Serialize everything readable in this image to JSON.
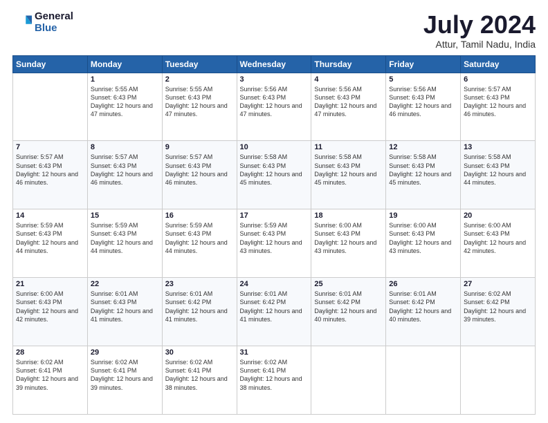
{
  "logo": {
    "general": "General",
    "blue": "Blue"
  },
  "title": "July 2024",
  "subtitle": "Attur, Tamil Nadu, India",
  "headers": [
    "Sunday",
    "Monday",
    "Tuesday",
    "Wednesday",
    "Thursday",
    "Friday",
    "Saturday"
  ],
  "weeks": [
    [
      {
        "day": "",
        "sunrise": "",
        "sunset": "",
        "daylight": ""
      },
      {
        "day": "1",
        "sunrise": "Sunrise: 5:55 AM",
        "sunset": "Sunset: 6:43 PM",
        "daylight": "Daylight: 12 hours and 47 minutes."
      },
      {
        "day": "2",
        "sunrise": "Sunrise: 5:55 AM",
        "sunset": "Sunset: 6:43 PM",
        "daylight": "Daylight: 12 hours and 47 minutes."
      },
      {
        "day": "3",
        "sunrise": "Sunrise: 5:56 AM",
        "sunset": "Sunset: 6:43 PM",
        "daylight": "Daylight: 12 hours and 47 minutes."
      },
      {
        "day": "4",
        "sunrise": "Sunrise: 5:56 AM",
        "sunset": "Sunset: 6:43 PM",
        "daylight": "Daylight: 12 hours and 47 minutes."
      },
      {
        "day": "5",
        "sunrise": "Sunrise: 5:56 AM",
        "sunset": "Sunset: 6:43 PM",
        "daylight": "Daylight: 12 hours and 46 minutes."
      },
      {
        "day": "6",
        "sunrise": "Sunrise: 5:57 AM",
        "sunset": "Sunset: 6:43 PM",
        "daylight": "Daylight: 12 hours and 46 minutes."
      }
    ],
    [
      {
        "day": "7",
        "sunrise": "Sunrise: 5:57 AM",
        "sunset": "Sunset: 6:43 PM",
        "daylight": "Daylight: 12 hours and 46 minutes."
      },
      {
        "day": "8",
        "sunrise": "Sunrise: 5:57 AM",
        "sunset": "Sunset: 6:43 PM",
        "daylight": "Daylight: 12 hours and 46 minutes."
      },
      {
        "day": "9",
        "sunrise": "Sunrise: 5:57 AM",
        "sunset": "Sunset: 6:43 PM",
        "daylight": "Daylight: 12 hours and 46 minutes."
      },
      {
        "day": "10",
        "sunrise": "Sunrise: 5:58 AM",
        "sunset": "Sunset: 6:43 PM",
        "daylight": "Daylight: 12 hours and 45 minutes."
      },
      {
        "day": "11",
        "sunrise": "Sunrise: 5:58 AM",
        "sunset": "Sunset: 6:43 PM",
        "daylight": "Daylight: 12 hours and 45 minutes."
      },
      {
        "day": "12",
        "sunrise": "Sunrise: 5:58 AM",
        "sunset": "Sunset: 6:43 PM",
        "daylight": "Daylight: 12 hours and 45 minutes."
      },
      {
        "day": "13",
        "sunrise": "Sunrise: 5:58 AM",
        "sunset": "Sunset: 6:43 PM",
        "daylight": "Daylight: 12 hours and 44 minutes."
      }
    ],
    [
      {
        "day": "14",
        "sunrise": "Sunrise: 5:59 AM",
        "sunset": "Sunset: 6:43 PM",
        "daylight": "Daylight: 12 hours and 44 minutes."
      },
      {
        "day": "15",
        "sunrise": "Sunrise: 5:59 AM",
        "sunset": "Sunset: 6:43 PM",
        "daylight": "Daylight: 12 hours and 44 minutes."
      },
      {
        "day": "16",
        "sunrise": "Sunrise: 5:59 AM",
        "sunset": "Sunset: 6:43 PM",
        "daylight": "Daylight: 12 hours and 44 minutes."
      },
      {
        "day": "17",
        "sunrise": "Sunrise: 5:59 AM",
        "sunset": "Sunset: 6:43 PM",
        "daylight": "Daylight: 12 hours and 43 minutes."
      },
      {
        "day": "18",
        "sunrise": "Sunrise: 6:00 AM",
        "sunset": "Sunset: 6:43 PM",
        "daylight": "Daylight: 12 hours and 43 minutes."
      },
      {
        "day": "19",
        "sunrise": "Sunrise: 6:00 AM",
        "sunset": "Sunset: 6:43 PM",
        "daylight": "Daylight: 12 hours and 43 minutes."
      },
      {
        "day": "20",
        "sunrise": "Sunrise: 6:00 AM",
        "sunset": "Sunset: 6:43 PM",
        "daylight": "Daylight: 12 hours and 42 minutes."
      }
    ],
    [
      {
        "day": "21",
        "sunrise": "Sunrise: 6:00 AM",
        "sunset": "Sunset: 6:43 PM",
        "daylight": "Daylight: 12 hours and 42 minutes."
      },
      {
        "day": "22",
        "sunrise": "Sunrise: 6:01 AM",
        "sunset": "Sunset: 6:43 PM",
        "daylight": "Daylight: 12 hours and 41 minutes."
      },
      {
        "day": "23",
        "sunrise": "Sunrise: 6:01 AM",
        "sunset": "Sunset: 6:42 PM",
        "daylight": "Daylight: 12 hours and 41 minutes."
      },
      {
        "day": "24",
        "sunrise": "Sunrise: 6:01 AM",
        "sunset": "Sunset: 6:42 PM",
        "daylight": "Daylight: 12 hours and 41 minutes."
      },
      {
        "day": "25",
        "sunrise": "Sunrise: 6:01 AM",
        "sunset": "Sunset: 6:42 PM",
        "daylight": "Daylight: 12 hours and 40 minutes."
      },
      {
        "day": "26",
        "sunrise": "Sunrise: 6:01 AM",
        "sunset": "Sunset: 6:42 PM",
        "daylight": "Daylight: 12 hours and 40 minutes."
      },
      {
        "day": "27",
        "sunrise": "Sunrise: 6:02 AM",
        "sunset": "Sunset: 6:42 PM",
        "daylight": "Daylight: 12 hours and 39 minutes."
      }
    ],
    [
      {
        "day": "28",
        "sunrise": "Sunrise: 6:02 AM",
        "sunset": "Sunset: 6:41 PM",
        "daylight": "Daylight: 12 hours and 39 minutes."
      },
      {
        "day": "29",
        "sunrise": "Sunrise: 6:02 AM",
        "sunset": "Sunset: 6:41 PM",
        "daylight": "Daylight: 12 hours and 39 minutes."
      },
      {
        "day": "30",
        "sunrise": "Sunrise: 6:02 AM",
        "sunset": "Sunset: 6:41 PM",
        "daylight": "Daylight: 12 hours and 38 minutes."
      },
      {
        "day": "31",
        "sunrise": "Sunrise: 6:02 AM",
        "sunset": "Sunset: 6:41 PM",
        "daylight": "Daylight: 12 hours and 38 minutes."
      },
      {
        "day": "",
        "sunrise": "",
        "sunset": "",
        "daylight": ""
      },
      {
        "day": "",
        "sunrise": "",
        "sunset": "",
        "daylight": ""
      },
      {
        "day": "",
        "sunrise": "",
        "sunset": "",
        "daylight": ""
      }
    ]
  ]
}
